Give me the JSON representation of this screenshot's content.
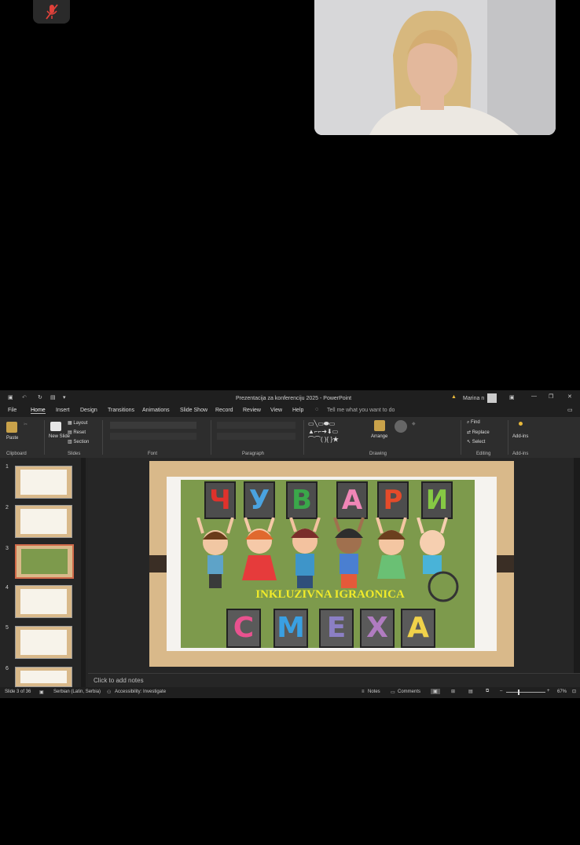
{
  "meeting": {
    "mic_icon": "mic-off-icon"
  },
  "titlebar": {
    "title": "Prezentacija za konferenciju 2025  -  PowerPoint",
    "user": "Marina n"
  },
  "tabs": [
    "File",
    "Home",
    "Insert",
    "Design",
    "Transitions",
    "Animations",
    "Slide Show",
    "Record",
    "Review",
    "View",
    "Help"
  ],
  "tell_me": "Tell me what you want to do",
  "ribbon": {
    "paste": "Paste",
    "new_slide": "New Slide",
    "layout": "Layout",
    "reset": "Reset",
    "section": "Section",
    "arrange": "Arrange",
    "find": "Find",
    "replace": "Replace",
    "select": "Select",
    "addins": "Add-ins",
    "groups": {
      "clipboard": "Clipboard",
      "slides": "Slides",
      "font": "Font",
      "paragraph": "Paragraph",
      "drawing": "Drawing",
      "editing": "Editing",
      "addins": "Add-ins"
    }
  },
  "thumbnails": {
    "numbers": [
      "1",
      "2",
      "3",
      "4",
      "5",
      "6"
    ],
    "selected": 3
  },
  "slide": {
    "top_letters": [
      "Ч",
      "У",
      "В",
      "А",
      "Р",
      "И"
    ],
    "top_colors": [
      "#e0322c",
      "#4aa3e0",
      "#3aa84a",
      "#ef86b6",
      "#e44b2a",
      "#86c944"
    ],
    "bottom_letters": [
      "С",
      "М",
      "Е",
      "Х",
      "А"
    ],
    "bottom_colors": [
      "#e9528f",
      "#3aa0e2",
      "#8b7fc4",
      "#b07cc0",
      "#f0d24a"
    ],
    "title": "INKLUZIVNA IGRAONICA"
  },
  "notes_placeholder": "Click to add notes",
  "status": {
    "slide": "Slide 3 of 36",
    "language": "Serbian (Latin, Serbia)",
    "accessibility": "Accessibility: Investigate",
    "notes": "Notes",
    "comments": "Comments",
    "zoom": "67%"
  }
}
